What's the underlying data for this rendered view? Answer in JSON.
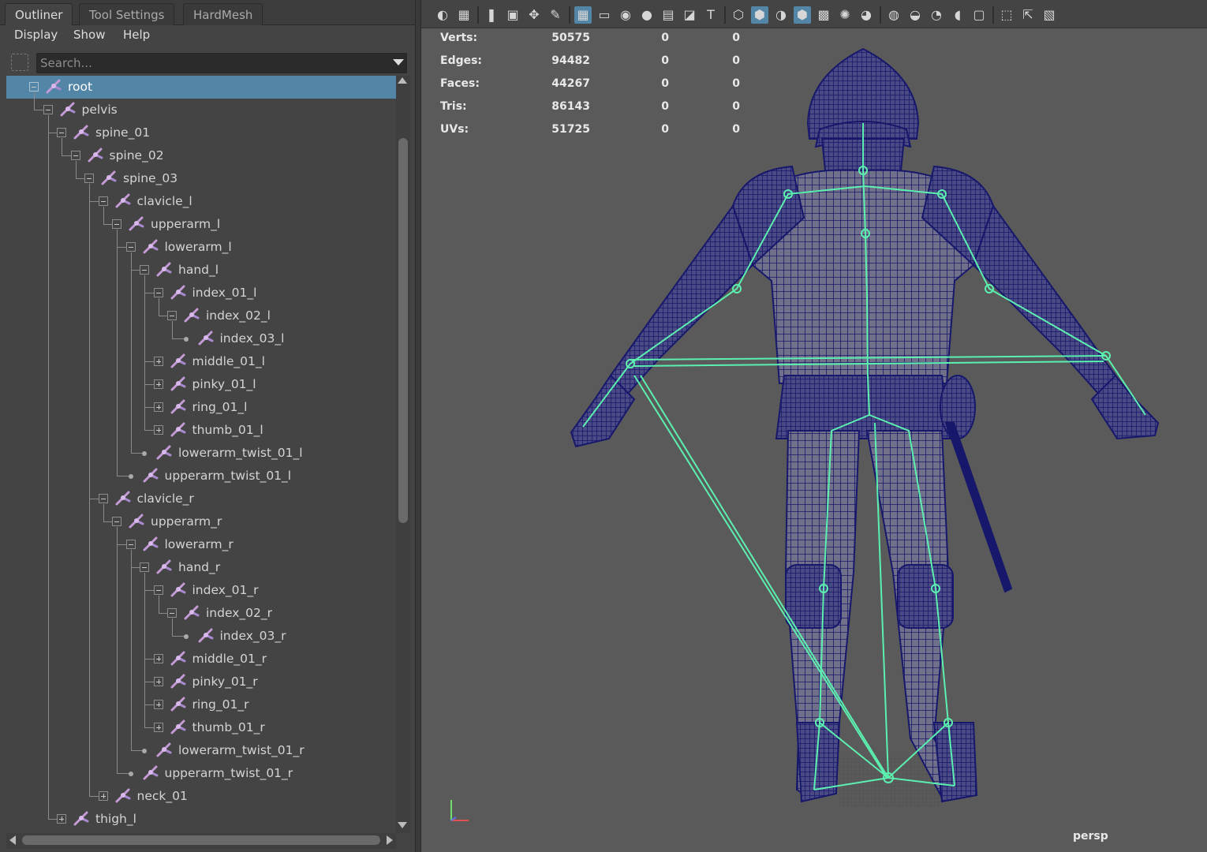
{
  "outliner": {
    "tabs": [
      {
        "label": "Outliner",
        "active": true
      },
      {
        "label": "Tool Settings",
        "active": false
      },
      {
        "label": "HardMesh",
        "active": false
      }
    ],
    "menus": [
      "Display",
      "Show",
      "Help"
    ],
    "search_placeholder": "Search...",
    "tree": [
      {
        "label": "root",
        "depth": 0,
        "expander": "minus",
        "selected": true
      },
      {
        "label": "pelvis",
        "depth": 1,
        "expander": "minus"
      },
      {
        "label": "spine_01",
        "depth": 2,
        "expander": "minus"
      },
      {
        "label": "spine_02",
        "depth": 3,
        "expander": "minus"
      },
      {
        "label": "spine_03",
        "depth": 4,
        "expander": "minus"
      },
      {
        "label": "clavicle_l",
        "depth": 5,
        "expander": "minus"
      },
      {
        "label": "upperarm_l",
        "depth": 6,
        "expander": "minus"
      },
      {
        "label": "lowerarm_l",
        "depth": 7,
        "expander": "minus"
      },
      {
        "label": "hand_l",
        "depth": 8,
        "expander": "minus"
      },
      {
        "label": "index_01_l",
        "depth": 9,
        "expander": "minus"
      },
      {
        "label": "index_02_l",
        "depth": 10,
        "expander": "minus"
      },
      {
        "label": "index_03_l",
        "depth": 11,
        "expander": "leaf"
      },
      {
        "label": "middle_01_l",
        "depth": 9,
        "expander": "plus"
      },
      {
        "label": "pinky_01_l",
        "depth": 9,
        "expander": "plus"
      },
      {
        "label": "ring_01_l",
        "depth": 9,
        "expander": "plus"
      },
      {
        "label": "thumb_01_l",
        "depth": 9,
        "expander": "plus"
      },
      {
        "label": "lowerarm_twist_01_l",
        "depth": 8,
        "expander": "leaf"
      },
      {
        "label": "upperarm_twist_01_l",
        "depth": 7,
        "expander": "leaf"
      },
      {
        "label": "clavicle_r",
        "depth": 5,
        "expander": "minus"
      },
      {
        "label": "upperarm_r",
        "depth": 6,
        "expander": "minus"
      },
      {
        "label": "lowerarm_r",
        "depth": 7,
        "expander": "minus"
      },
      {
        "label": "hand_r",
        "depth": 8,
        "expander": "minus"
      },
      {
        "label": "index_01_r",
        "depth": 9,
        "expander": "minus"
      },
      {
        "label": "index_02_r",
        "depth": 10,
        "expander": "minus"
      },
      {
        "label": "index_03_r",
        "depth": 11,
        "expander": "leaf"
      },
      {
        "label": "middle_01_r",
        "depth": 9,
        "expander": "plus"
      },
      {
        "label": "pinky_01_r",
        "depth": 9,
        "expander": "plus"
      },
      {
        "label": "ring_01_r",
        "depth": 9,
        "expander": "plus"
      },
      {
        "label": "thumb_01_r",
        "depth": 9,
        "expander": "plus"
      },
      {
        "label": "lowerarm_twist_01_r",
        "depth": 8,
        "expander": "leaf"
      },
      {
        "label": "upperarm_twist_01_r",
        "depth": 7,
        "expander": "leaf"
      },
      {
        "label": "neck_01",
        "depth": 5,
        "expander": "plus"
      },
      {
        "label": "thigh_l",
        "depth": 2,
        "expander": "plus"
      }
    ]
  },
  "viewport": {
    "camera": "persp",
    "hud": [
      {
        "label": "Verts:",
        "v1": "50575",
        "v2": "0",
        "v3": "0"
      },
      {
        "label": "Edges:",
        "v1": "94482",
        "v2": "0",
        "v3": "0"
      },
      {
        "label": "Faces:",
        "v1": "44267",
        "v2": "0",
        "v3": "0"
      },
      {
        "label": "Tris:",
        "v1": "86143",
        "v2": "0",
        "v3": "0"
      },
      {
        "label": "UVs:",
        "v1": "51725",
        "v2": "0",
        "v3": "0"
      }
    ],
    "toolbar_icons": [
      "camera-select-icon",
      "camera-attributes-icon",
      "bookmark-icon",
      "image-plane-icon",
      "two-d-pan-icon",
      "grease-pencil-icon",
      "grid-icon",
      "film-gate-icon",
      "resolution-gate-icon",
      "gate-mask-icon",
      "field-chart-icon",
      "safe-action-icon",
      "safe-title-icon",
      "wireframe-icon",
      "smooth-shade-icon",
      "wireframe-on-shaded-icon",
      "shaded-wire-icon",
      "textured-icon",
      "lights-icon",
      "shadows-icon",
      "screen-space-ao-icon",
      "motion-blur-icon",
      "anti-alias-icon",
      "depth-of-field-icon",
      "isolate-select-icon",
      "xray-icon",
      "xray-joints-icon",
      "backface-icon"
    ],
    "colors": {
      "background": "#5a5a5a",
      "wireframe": "#17186b",
      "mesh_fill": "#6e6e86",
      "skeleton": "#5cf0b0",
      "selection": "#5285a6"
    }
  }
}
